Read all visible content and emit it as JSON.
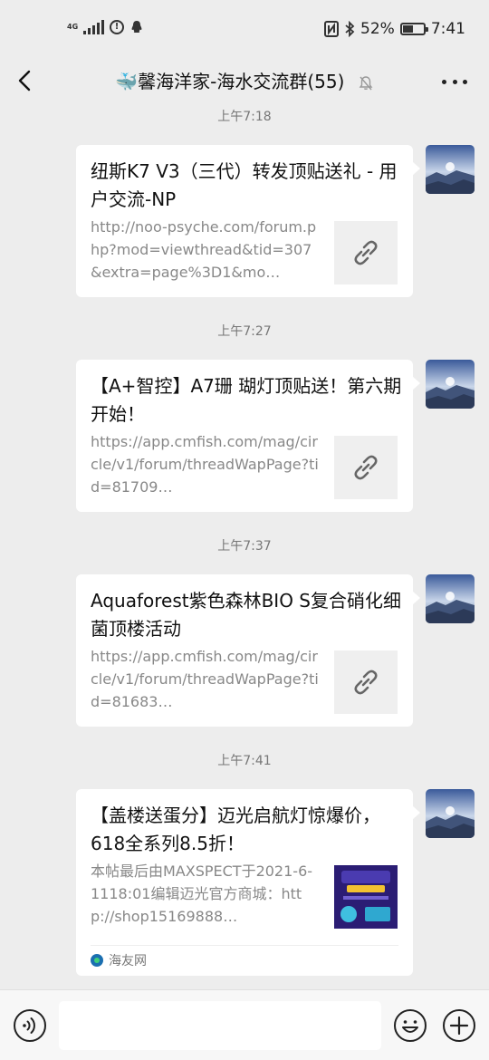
{
  "status_bar": {
    "network": "4G",
    "battery_percent": "52%",
    "battery_level": 0.52,
    "time": "7:41",
    "icons": [
      "signal-icon",
      "alert-circle-icon",
      "qq-penguin-icon",
      "nfc-icon",
      "bluetooth-icon",
      "battery-icon"
    ]
  },
  "header": {
    "title": "🐳馨海洋家-海水交流群(55)",
    "muted": true
  },
  "messages": [
    {
      "time": "上午7:18",
      "title": "纽斯K7 V3（三代）转发顶贴送礼 - 用户交流-NP",
      "desc": "http://noo-psyche.com/forum.php?mod=viewthread&tid=307&extra=page%3D1&mo…",
      "thumb": "link-icon"
    },
    {
      "time": "上午7:27",
      "title": "【A+智控】A7珊 瑚灯顶贴送！第六期开始！",
      "desc": "https://app.cmfish.com/mag/circle/v1/forum/threadWapPage?tid=81709…",
      "thumb": "link-icon"
    },
    {
      "time": "上午7:37",
      "title": "Aquaforest紫色森林BIO S复合硝化细菌顶楼活动",
      "desc": "https://app.cmfish.com/mag/circle/v1/forum/threadWapPage?tid=81683…",
      "thumb": "link-icon"
    },
    {
      "time": "上午7:41",
      "title": "【盖楼送蛋分】迈光启航灯惊爆价，618全系列8.5折！",
      "desc": "本帖最后由MAXSPECT于2021-6-1118:01编辑迈光官方商城：http://shop15169888…",
      "thumb": "promo-image",
      "source": "海友网"
    }
  ],
  "colors": {
    "background": "#ededed",
    "card": "#ffffff",
    "muted_text": "#888888"
  }
}
